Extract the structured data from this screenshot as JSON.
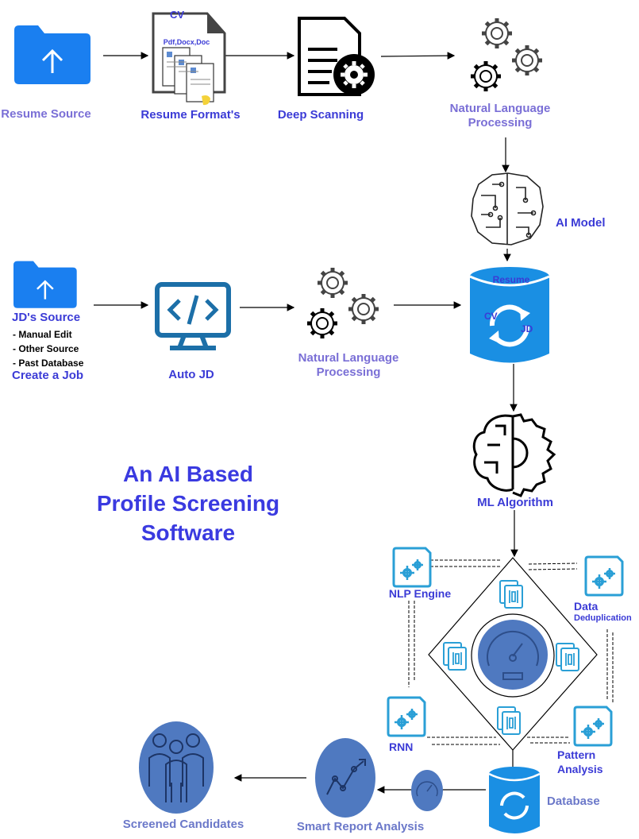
{
  "diagram": {
    "title": [
      "An AI Based",
      "Profile Screening",
      "Software"
    ],
    "nodes": {
      "resume_source": "Resume Source",
      "resume_formats": "Resume Format's",
      "cv_tag": "CV",
      "formats_tag": "Pdf,Docx,Doc",
      "deep_scanning": "Deep Scanning",
      "nlp_top": [
        "Natural Language",
        "Processing"
      ],
      "ai_model": "AI Model",
      "jd_source": "JD's Source",
      "jd_options": [
        "- Manual Edit",
        "- Other Source",
        "- Past Database"
      ],
      "create_job": "Create a Job",
      "auto_jd": "Auto JD",
      "nlp_mid": [
        "Natural Language",
        "Processing"
      ],
      "db_resume": "Resume",
      "db_cv": "CV",
      "db_jd": "JD",
      "ml_algorithm": "ML Algorithm",
      "nlp_engine": "NLP Engine",
      "data_dedup": [
        "Data",
        "Deduplication"
      ],
      "rnn": "RNN",
      "pattern_analysis": [
        "Pattern",
        "Analysis"
      ],
      "database": "Database",
      "smart_report": "Smart Report Analysis",
      "screened_candidates": "Screened Candidates"
    },
    "colors": {
      "folder_blue": "#1a7ff0",
      "db_blue": "#1a8fe3",
      "accent_blue": "#3b3bd6",
      "label_violet": "#7a6fd6",
      "circle_steel": "#4f79c0",
      "icon_blue": "#2a9fd6"
    },
    "icons": [
      "folder-upload-icon",
      "documents-icon",
      "document-gear-icon",
      "gears-icon",
      "circuit-head-icon",
      "monitor-code-icon",
      "database-sync-icon",
      "ai-brain-gear-icon",
      "gear-doc-icon",
      "speedometer-icon",
      "line-chart-icon",
      "people-group-icon"
    ]
  }
}
